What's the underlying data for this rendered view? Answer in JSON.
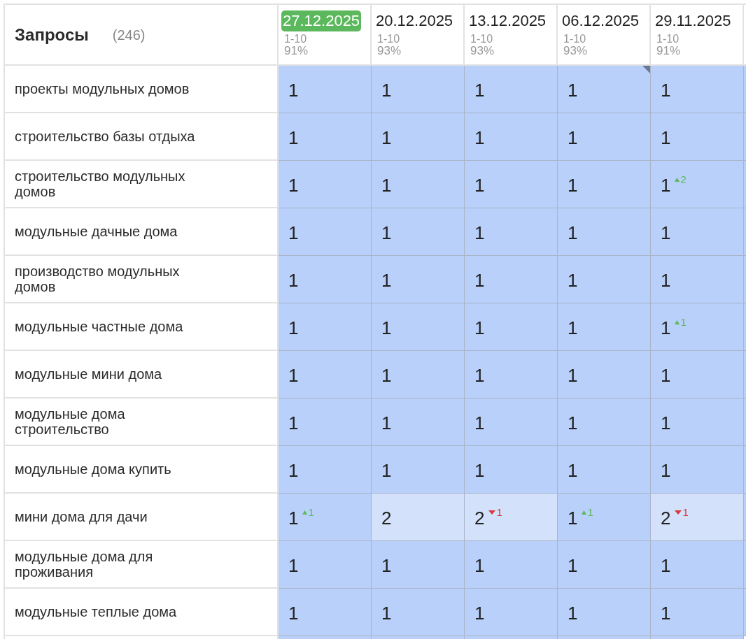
{
  "header": {
    "title": "Запросы",
    "count": "(246)"
  },
  "dates": [
    {
      "date": "27.12.2025",
      "range": "1-10",
      "percent": "91%",
      "selected": true
    },
    {
      "date": "20.12.2025",
      "range": "1-10",
      "percent": "93%",
      "selected": false
    },
    {
      "date": "13.12.2025",
      "range": "1-10",
      "percent": "93%",
      "selected": false
    },
    {
      "date": "06.12.2025",
      "range": "1-10",
      "percent": "93%",
      "selected": false
    },
    {
      "date": "29.11.2025",
      "range": "1-10",
      "percent": "91%",
      "selected": false
    }
  ],
  "rows": [
    {
      "query": "проекты модульных домов",
      "cells": [
        {
          "value": "1",
          "kind": "top",
          "note": false
        },
        {
          "value": "1",
          "kind": "top",
          "note": false
        },
        {
          "value": "1",
          "kind": "top",
          "note": false
        },
        {
          "value": "1",
          "kind": "top",
          "note": true
        },
        {
          "value": "1",
          "kind": "top",
          "note": false
        }
      ]
    },
    {
      "query": "строительство базы отдыха",
      "cells": [
        {
          "value": "1",
          "kind": "top",
          "note": false
        },
        {
          "value": "1",
          "kind": "top",
          "note": false
        },
        {
          "value": "1",
          "kind": "top",
          "note": false
        },
        {
          "value": "1",
          "kind": "top",
          "note": false
        },
        {
          "value": "1",
          "kind": "top",
          "note": false
        }
      ]
    },
    {
      "query": "строительство модульных домов",
      "cells": [
        {
          "value": "1",
          "kind": "top",
          "note": false
        },
        {
          "value": "1",
          "kind": "top",
          "note": false
        },
        {
          "value": "1",
          "kind": "top",
          "note": false
        },
        {
          "value": "1",
          "kind": "top",
          "note": false
        },
        {
          "value": "1",
          "kind": "top",
          "note": false,
          "change": {
            "rising": true,
            "amount": "2"
          }
        }
      ]
    },
    {
      "query": "модульные дачные дома",
      "cells": [
        {
          "value": "1",
          "kind": "top",
          "note": false
        },
        {
          "value": "1",
          "kind": "top",
          "note": false
        },
        {
          "value": "1",
          "kind": "top",
          "note": false
        },
        {
          "value": "1",
          "kind": "top",
          "note": false
        },
        {
          "value": "1",
          "kind": "top",
          "note": false
        }
      ]
    },
    {
      "query": "производство модульных домов",
      "cells": [
        {
          "value": "1",
          "kind": "top",
          "note": false
        },
        {
          "value": "1",
          "kind": "top",
          "note": false
        },
        {
          "value": "1",
          "kind": "top",
          "note": false
        },
        {
          "value": "1",
          "kind": "top",
          "note": false
        },
        {
          "value": "1",
          "kind": "top",
          "note": false
        }
      ]
    },
    {
      "query": "модульные частные дома",
      "cells": [
        {
          "value": "1",
          "kind": "top",
          "note": false
        },
        {
          "value": "1",
          "kind": "top",
          "note": false
        },
        {
          "value": "1",
          "kind": "top",
          "note": false
        },
        {
          "value": "1",
          "kind": "top",
          "note": false
        },
        {
          "value": "1",
          "kind": "top",
          "note": false,
          "change": {
            "rising": true,
            "amount": "1"
          }
        }
      ]
    },
    {
      "query": "модульные мини дома",
      "cells": [
        {
          "value": "1",
          "kind": "top",
          "note": false
        },
        {
          "value": "1",
          "kind": "top",
          "note": false
        },
        {
          "value": "1",
          "kind": "top",
          "note": false
        },
        {
          "value": "1",
          "kind": "top",
          "note": false
        },
        {
          "value": "1",
          "kind": "top",
          "note": false
        }
      ]
    },
    {
      "query": "модульные дома строительство",
      "cells": [
        {
          "value": "1",
          "kind": "top",
          "note": false
        },
        {
          "value": "1",
          "kind": "top",
          "note": false
        },
        {
          "value": "1",
          "kind": "top",
          "note": false
        },
        {
          "value": "1",
          "kind": "top",
          "note": false
        },
        {
          "value": "1",
          "kind": "top",
          "note": false
        }
      ]
    },
    {
      "query": "модульные дома купить",
      "cells": [
        {
          "value": "1",
          "kind": "top",
          "note": false
        },
        {
          "value": "1",
          "kind": "top",
          "note": false
        },
        {
          "value": "1",
          "kind": "top",
          "note": false
        },
        {
          "value": "1",
          "kind": "top",
          "note": false
        },
        {
          "value": "1",
          "kind": "top",
          "note": false
        }
      ]
    },
    {
      "query": "мини дома для дачи",
      "cells": [
        {
          "value": "1",
          "kind": "top",
          "note": false,
          "change": {
            "rising": true,
            "amount": "1"
          }
        },
        {
          "value": "2",
          "kind": "near",
          "note": false
        },
        {
          "value": "2",
          "kind": "near",
          "note": false,
          "change": {
            "rising": false,
            "amount": "1"
          }
        },
        {
          "value": "1",
          "kind": "top",
          "note": false,
          "change": {
            "rising": true,
            "amount": "1"
          }
        },
        {
          "value": "2",
          "kind": "near",
          "note": false,
          "change": {
            "rising": false,
            "amount": "1"
          }
        }
      ]
    },
    {
      "query": "модульные дома для проживания",
      "cells": [
        {
          "value": "1",
          "kind": "top",
          "note": false
        },
        {
          "value": "1",
          "kind": "top",
          "note": false
        },
        {
          "value": "1",
          "kind": "top",
          "note": false
        },
        {
          "value": "1",
          "kind": "top",
          "note": false
        },
        {
          "value": "1",
          "kind": "top",
          "note": false
        }
      ]
    },
    {
      "query": "модульные теплые дома",
      "cells": [
        {
          "value": "1",
          "kind": "top",
          "note": false
        },
        {
          "value": "1",
          "kind": "top",
          "note": false
        },
        {
          "value": "1",
          "kind": "top",
          "note": false
        },
        {
          "value": "1",
          "kind": "top",
          "note": false
        },
        {
          "value": "1",
          "kind": "top",
          "note": false
        }
      ]
    }
  ]
}
